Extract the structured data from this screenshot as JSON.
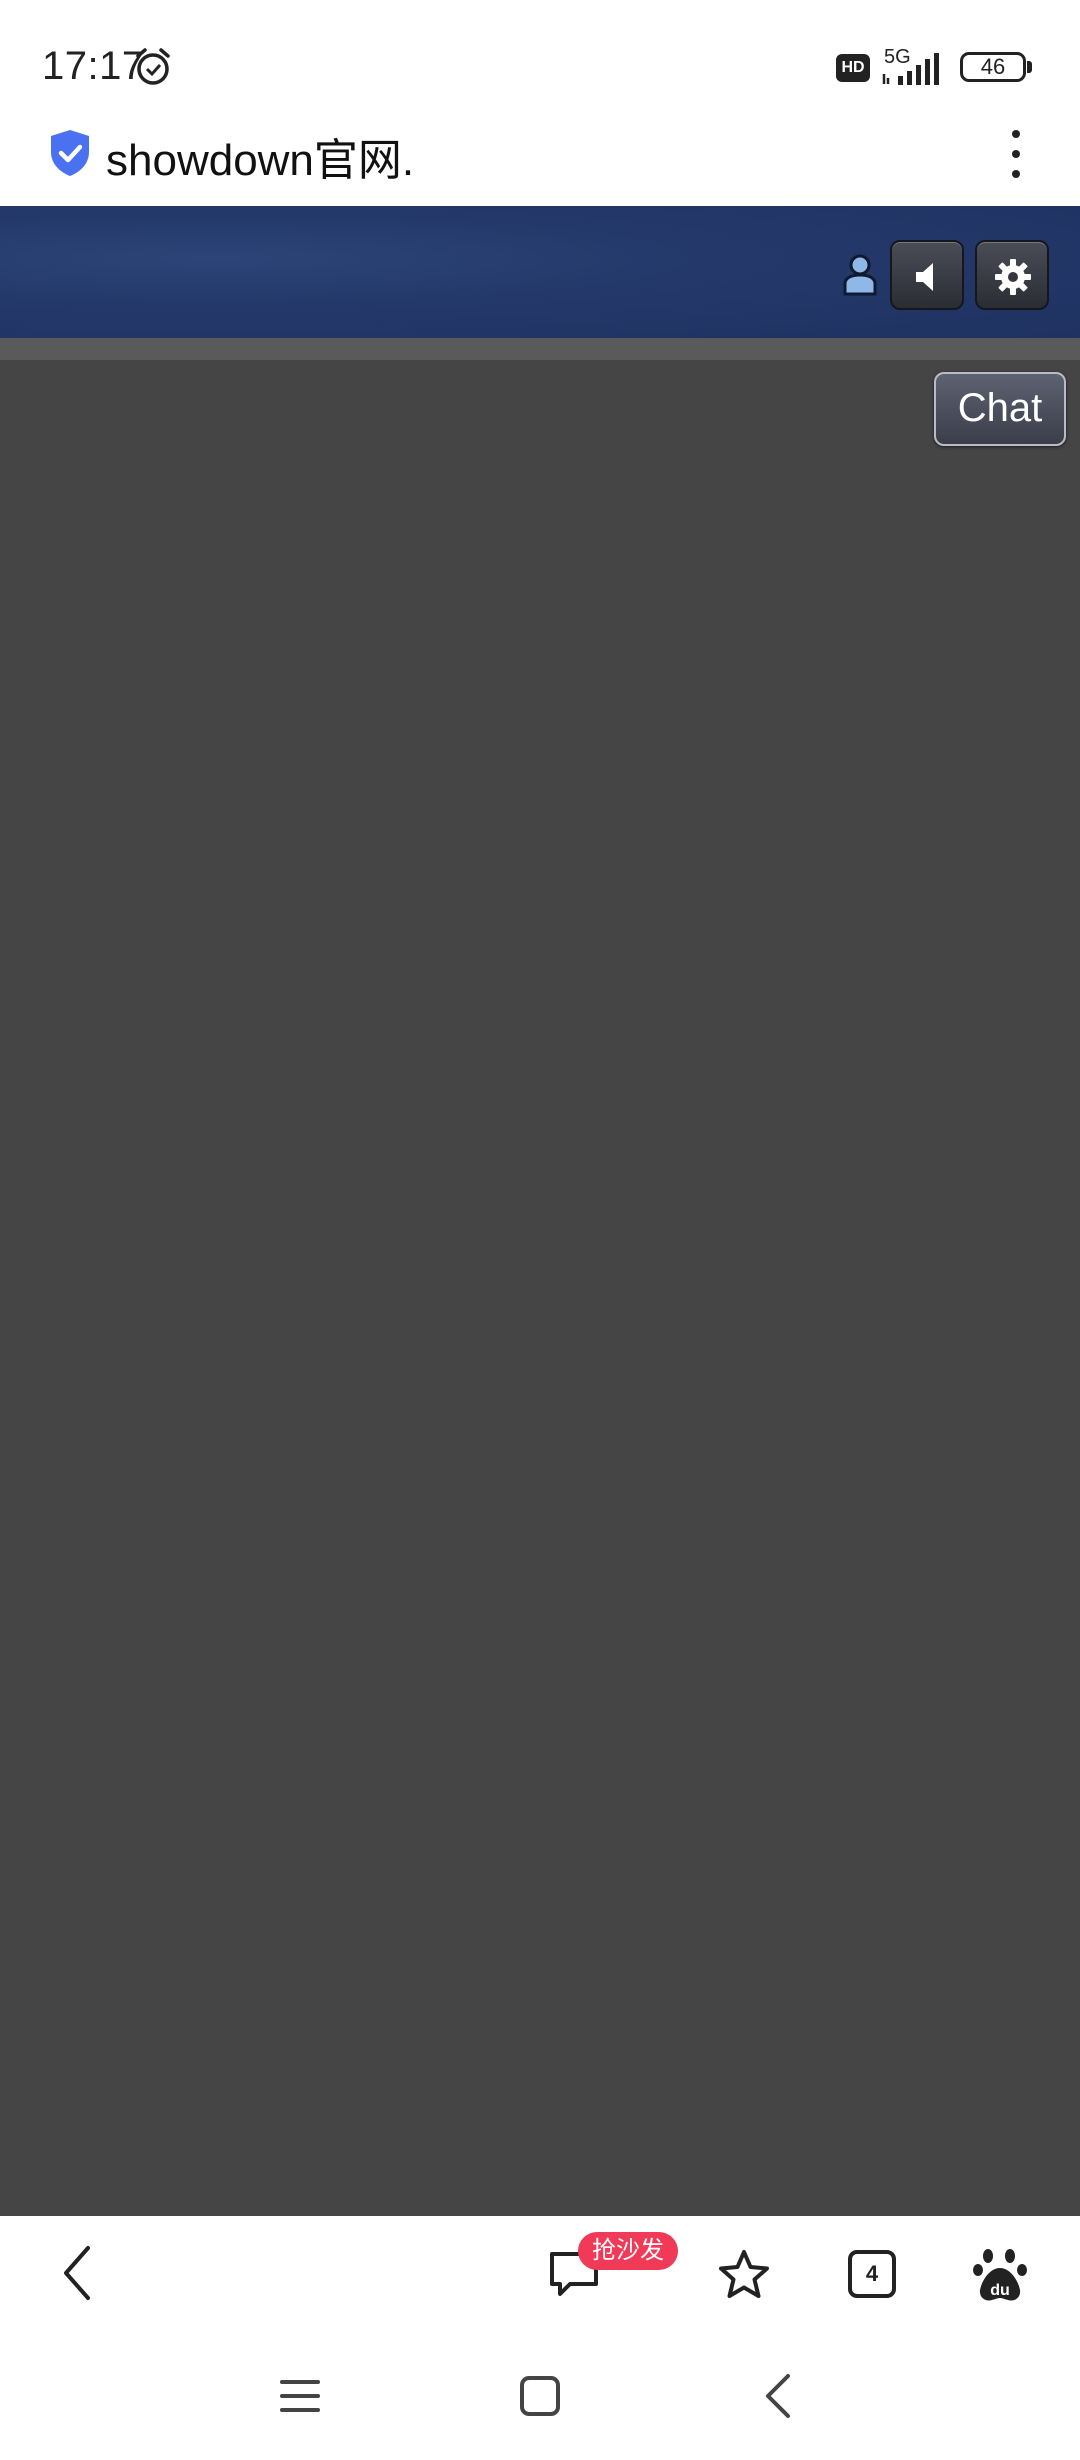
{
  "status_bar": {
    "time": "17:17",
    "hd_label": "HD",
    "network_label": "5G",
    "battery_level": "46"
  },
  "browser": {
    "url_text": "showdown官网.",
    "tab_count": "4",
    "comment_badge": "抢沙发"
  },
  "site": {
    "chat_button_label": "Chat"
  },
  "colors": {
    "header_bg": "#24396a",
    "main_bg": "#454545",
    "badge_red": "#f03a57",
    "shield_blue": "#4a72f0"
  }
}
